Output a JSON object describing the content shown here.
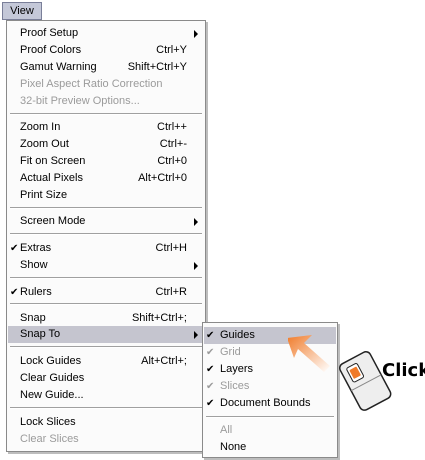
{
  "menubar": {
    "view_label": "View"
  },
  "view_menu": {
    "items": [
      {
        "label": "Proof Setup",
        "shortcut": "",
        "submenu": true,
        "enabled": true
      },
      {
        "label": "Proof Colors",
        "shortcut": "Ctrl+Y",
        "enabled": true
      },
      {
        "label": "Gamut Warning",
        "shortcut": "Shift+Ctrl+Y",
        "enabled": true
      },
      {
        "label": "Pixel Aspect Ratio Correction",
        "shortcut": "",
        "enabled": false
      },
      {
        "label": "32-bit Preview Options...",
        "shortcut": "",
        "enabled": false
      },
      {
        "label": "Zoom In",
        "shortcut": "Ctrl++",
        "enabled": true
      },
      {
        "label": "Zoom Out",
        "shortcut": "Ctrl+-",
        "enabled": true
      },
      {
        "label": "Fit on Screen",
        "shortcut": "Ctrl+0",
        "enabled": true
      },
      {
        "label": "Actual Pixels",
        "shortcut": "Alt+Ctrl+0",
        "enabled": true
      },
      {
        "label": "Print Size",
        "shortcut": "",
        "enabled": true
      },
      {
        "label": "Screen Mode",
        "shortcut": "",
        "submenu": true,
        "enabled": true
      },
      {
        "label": "Extras",
        "shortcut": "Ctrl+H",
        "checked": true,
        "enabled": true
      },
      {
        "label": "Show",
        "shortcut": "",
        "submenu": true,
        "enabled": true
      },
      {
        "label": "Rulers",
        "shortcut": "Ctrl+R",
        "checked": true,
        "enabled": true
      },
      {
        "label": "Snap",
        "shortcut": "Shift+Ctrl+;",
        "enabled": true
      },
      {
        "label": "Snap To",
        "shortcut": "",
        "submenu": true,
        "highlighted": true,
        "enabled": true
      },
      {
        "label": "Lock Guides",
        "shortcut": "Alt+Ctrl+;",
        "enabled": true
      },
      {
        "label": "Clear Guides",
        "shortcut": "",
        "enabled": true
      },
      {
        "label": "New Guide...",
        "shortcut": "",
        "enabled": true
      },
      {
        "label": "Lock Slices",
        "shortcut": "",
        "enabled": true
      },
      {
        "label": "Clear Slices",
        "shortcut": "",
        "enabled": false
      }
    ]
  },
  "snap_to_menu": {
    "items": [
      {
        "label": "Guides",
        "checked": true,
        "enabled": true,
        "highlighted": true
      },
      {
        "label": "Grid",
        "checked": true,
        "enabled": false
      },
      {
        "label": "Layers",
        "checked": true,
        "enabled": true
      },
      {
        "label": "Slices",
        "checked": true,
        "enabled": false
      },
      {
        "label": "Document Bounds",
        "checked": true,
        "enabled": true
      },
      {
        "label": "All",
        "enabled": false
      },
      {
        "label": "None",
        "enabled": true
      }
    ]
  },
  "annotation": {
    "click_label": "Click",
    "arrow_color": "#f07a28"
  },
  "colors": {
    "highlight": "#c5c5cf",
    "disabled_text": "#9b9b9b",
    "menubar_active": "#c4c8d8"
  }
}
